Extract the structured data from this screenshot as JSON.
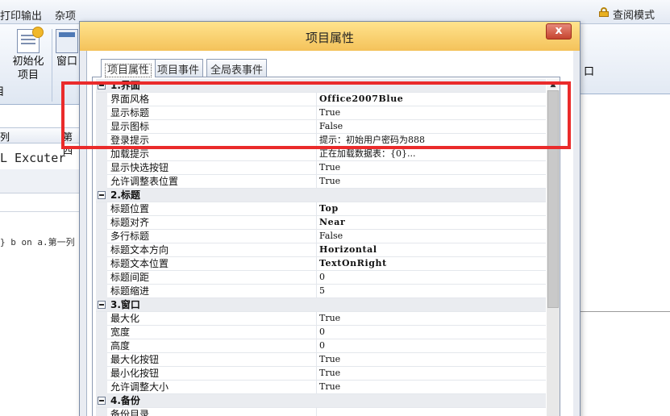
{
  "app": {
    "menu": [
      "打印输出",
      "杂项"
    ],
    "mode_label": "查阅模式",
    "ribbon": {
      "init_project": "初始化项目",
      "window": "窗口",
      "right_char": "口"
    },
    "grid_header": {
      "col_a": "列",
      "col_b": "第四"
    },
    "sql_tab": "L Excuter",
    "sql_text": "} b on a.第一列 ="
  },
  "dialog": {
    "title": "项目属性",
    "close_symbol": "x",
    "tabs": [
      "项目属性",
      "项目事件",
      "全局表事件"
    ],
    "active_tab": 0
  },
  "property_grid": {
    "groups": [
      {
        "label": "1.界面",
        "rows": [
          {
            "name": "界面风格",
            "value": "Office2007Blue",
            "bold": true
          },
          {
            "name": "显示标题",
            "value": "True"
          },
          {
            "name": "显示图标",
            "value": "False"
          },
          {
            "name": "登录提示",
            "value": "提示：初始用户密码为888"
          },
          {
            "name": "加载提示",
            "value": "正在加载数据表：{0}..."
          },
          {
            "name": "显示快选按钮",
            "value": "True"
          },
          {
            "name": "允许调整表位置",
            "value": "True"
          }
        ]
      },
      {
        "label": "2.标题",
        "rows": [
          {
            "name": "标题位置",
            "value": "Top",
            "bold": true
          },
          {
            "name": "标题对齐",
            "value": "Near",
            "bold": true
          },
          {
            "name": "多行标题",
            "value": "False"
          },
          {
            "name": "标题文本方向",
            "value": "Horizontal",
            "bold": true
          },
          {
            "name": "标题文本位置",
            "value": "TextOnRight",
            "bold": true
          },
          {
            "name": "标题间距",
            "value": "0"
          },
          {
            "name": "标题缩进",
            "value": "5"
          }
        ]
      },
      {
        "label": "3.窗口",
        "rows": [
          {
            "name": "最大化",
            "value": "True"
          },
          {
            "name": "宽度",
            "value": "0"
          },
          {
            "name": "高度",
            "value": "0"
          },
          {
            "name": "最大化按钮",
            "value": "True"
          },
          {
            "name": "最小化按钮",
            "value": "True"
          },
          {
            "name": "允许调整大小",
            "value": "True"
          }
        ]
      },
      {
        "label": "4.备份",
        "rows": [
          {
            "name": "备份目录",
            "value": ""
          }
        ]
      }
    ]
  },
  "colors": {
    "highlight": "#ea2b2b",
    "titlebar": "#f4c25a",
    "close_button": "#c6442f"
  }
}
